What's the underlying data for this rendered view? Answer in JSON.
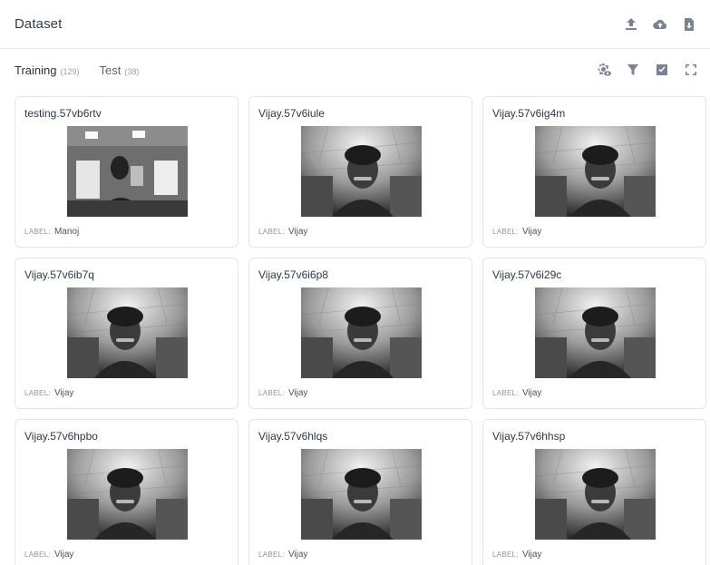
{
  "header": {
    "title": "Dataset",
    "icons": [
      "upload-icon",
      "cloud-upload-icon",
      "file-download-icon"
    ]
  },
  "tabs": [
    {
      "label": "Training",
      "count": "(129)",
      "active": true
    },
    {
      "label": "Test",
      "count": "(38)",
      "active": false
    }
  ],
  "toolbar": {
    "icons": [
      "settings-view-icon",
      "filter-icon",
      "select-all-icon",
      "fullscreen-icon"
    ]
  },
  "label_key": "LABEL:",
  "samples": [
    {
      "name": "testing.57vb6rtv",
      "label": "Manoj",
      "scene": "office"
    },
    {
      "name": "Vijay.57v6iule",
      "label": "Vijay",
      "scene": "face"
    },
    {
      "name": "Vijay.57v6ig4m",
      "label": "Vijay",
      "scene": "face"
    },
    {
      "name": "Vijay.57v6ib7q",
      "label": "Vijay",
      "scene": "face"
    },
    {
      "name": "Vijay.57v6i6p8",
      "label": "Vijay",
      "scene": "face"
    },
    {
      "name": "Vijay.57v6i29c",
      "label": "Vijay",
      "scene": "face"
    },
    {
      "name": "Vijay.57v6hpbo",
      "label": "Vijay",
      "scene": "face"
    },
    {
      "name": "Vijay.57v6hlqs",
      "label": "Vijay",
      "scene": "face"
    },
    {
      "name": "Vijay.57v6hhsp",
      "label": "Vijay",
      "scene": "face"
    }
  ]
}
